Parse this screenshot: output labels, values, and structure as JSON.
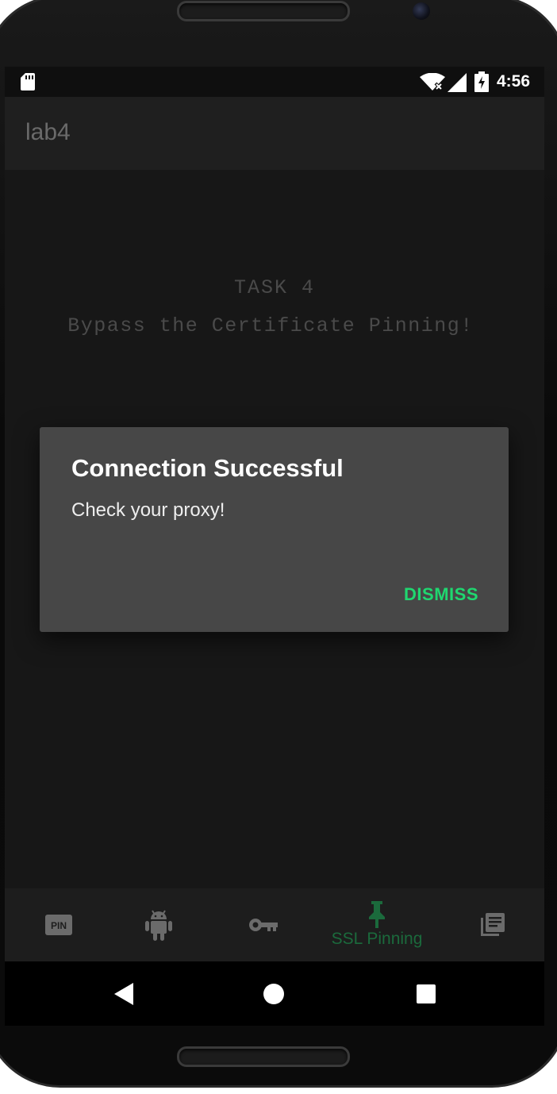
{
  "status_bar": {
    "time": "4:56",
    "icons": [
      "sd-card-icon",
      "wifi-icon",
      "signal-icon",
      "battery-charging-icon"
    ]
  },
  "app_bar": {
    "title": "lab4"
  },
  "task": {
    "title": "TASK 4",
    "subtitle": "Bypass the Certificate Pinning!"
  },
  "dialog": {
    "title": "Connection Successful",
    "message": "Check your proxy!",
    "dismiss_label": "DISMISS"
  },
  "bottom_nav": {
    "items": [
      {
        "icon": "pin-icon",
        "label": ""
      },
      {
        "icon": "android-icon",
        "label": ""
      },
      {
        "icon": "key-icon",
        "label": ""
      },
      {
        "icon": "push-pin-icon",
        "label": "SSL Pinning",
        "selected": true
      },
      {
        "icon": "library-books-icon",
        "label": ""
      }
    ]
  },
  "system_nav": {
    "icons": [
      "back-icon",
      "home-icon",
      "recents-icon"
    ]
  },
  "colors": {
    "accent": "#1fd870",
    "selected_nav": "#1b6a3c",
    "background": "#171717",
    "dialog_bg": "#474747"
  }
}
